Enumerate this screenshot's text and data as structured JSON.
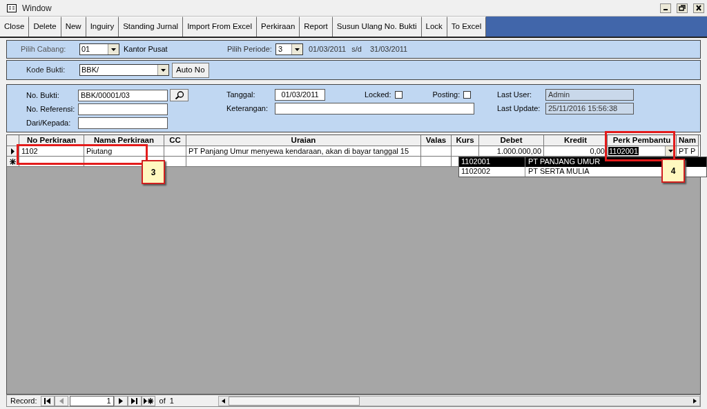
{
  "window": {
    "title": "Window"
  },
  "toolbar": [
    "Close",
    "Delete",
    "New",
    "Inguiry",
    "Standing Jurnal",
    "Import From Excel",
    "Perkiraan",
    "Report",
    "Susun Ulang No. Bukti",
    "Lock",
    "To Excel"
  ],
  "period_panel": {
    "cabang_label": "Pilih Cabang:",
    "cabang_value": "01",
    "cabang_name": "Kantor Pusat",
    "periode_label": "Pilih Periode:",
    "periode_value": "3",
    "date_from": "01/03/2011",
    "sd": "s/d",
    "date_to": "31/03/2011"
  },
  "kode_panel": {
    "label": "Kode Bukti:",
    "value": "BBK/",
    "button": "Auto No"
  },
  "header_form": {
    "no_bukti_label": "No. Bukti:",
    "no_bukti": "BBK/00001/03",
    "no_referensi_label": "No. Referensi:",
    "dari_label": "Dari/Kepada:",
    "tanggal_label": "Tanggal:",
    "tanggal": "01/03/2011",
    "keterangan_label": "Keterangan:",
    "locked_label": "Locked:",
    "locked": false,
    "posting_label": "Posting:",
    "posting": false,
    "last_user_label": "Last User:",
    "last_user": "Admin",
    "last_update_label": "Last Update:",
    "last_update": "25/11/2016 15:56:38"
  },
  "table": {
    "columns": [
      "No Perkiraan",
      "Nama Perkiraan",
      "CC",
      "Uraian",
      "Valas",
      "Kurs",
      "Debet",
      "Kredit",
      "Perk Pembantu",
      "Nam"
    ],
    "rows": [
      {
        "current": true,
        "cells": [
          "1102",
          "Piutang",
          "",
          "PT Panjang Umur menyewa kendaraan, akan di bayar tanggal 15",
          "",
          "",
          "1.000.000,00",
          "0,00",
          "1102001",
          "PT P"
        ]
      }
    ]
  },
  "dropdown": [
    {
      "code": "1102001",
      "name": "PT PANJANG UMUR",
      "selected": true
    },
    {
      "code": "1102002",
      "name": "PT SERTA MULIA",
      "selected": false
    }
  ],
  "callouts": [
    {
      "label": "3"
    },
    {
      "label": "4"
    }
  ],
  "record_bar": {
    "label": "Record:",
    "current": "1",
    "of": "of",
    "total": "1",
    "nav": [
      {
        "kind": "first",
        "disabled": false
      },
      {
        "kind": "prev",
        "disabled": true
      },
      {
        "kind": "next",
        "disabled": false
      },
      {
        "kind": "last",
        "disabled": false
      },
      {
        "kind": "new",
        "disabled": false
      }
    ]
  }
}
